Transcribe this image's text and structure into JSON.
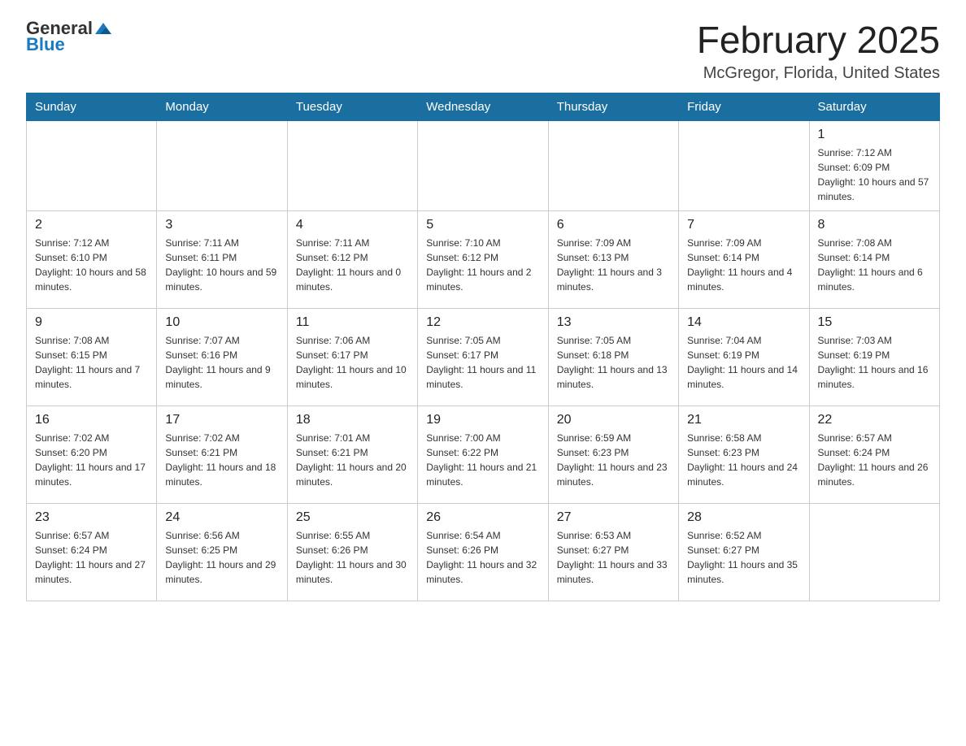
{
  "header": {
    "logo": {
      "general": "General",
      "blue": "Blue"
    },
    "title": "February 2025",
    "location": "McGregor, Florida, United States"
  },
  "weekdays": [
    "Sunday",
    "Monday",
    "Tuesday",
    "Wednesday",
    "Thursday",
    "Friday",
    "Saturday"
  ],
  "weeks": [
    [
      {
        "day": "",
        "sunrise": "",
        "sunset": "",
        "daylight": ""
      },
      {
        "day": "",
        "sunrise": "",
        "sunset": "",
        "daylight": ""
      },
      {
        "day": "",
        "sunrise": "",
        "sunset": "",
        "daylight": ""
      },
      {
        "day": "",
        "sunrise": "",
        "sunset": "",
        "daylight": ""
      },
      {
        "day": "",
        "sunrise": "",
        "sunset": "",
        "daylight": ""
      },
      {
        "day": "",
        "sunrise": "",
        "sunset": "",
        "daylight": ""
      },
      {
        "day": "1",
        "sunrise": "Sunrise: 7:12 AM",
        "sunset": "Sunset: 6:09 PM",
        "daylight": "Daylight: 10 hours and 57 minutes."
      }
    ],
    [
      {
        "day": "2",
        "sunrise": "Sunrise: 7:12 AM",
        "sunset": "Sunset: 6:10 PM",
        "daylight": "Daylight: 10 hours and 58 minutes."
      },
      {
        "day": "3",
        "sunrise": "Sunrise: 7:11 AM",
        "sunset": "Sunset: 6:11 PM",
        "daylight": "Daylight: 10 hours and 59 minutes."
      },
      {
        "day": "4",
        "sunrise": "Sunrise: 7:11 AM",
        "sunset": "Sunset: 6:12 PM",
        "daylight": "Daylight: 11 hours and 0 minutes."
      },
      {
        "day": "5",
        "sunrise": "Sunrise: 7:10 AM",
        "sunset": "Sunset: 6:12 PM",
        "daylight": "Daylight: 11 hours and 2 minutes."
      },
      {
        "day": "6",
        "sunrise": "Sunrise: 7:09 AM",
        "sunset": "Sunset: 6:13 PM",
        "daylight": "Daylight: 11 hours and 3 minutes."
      },
      {
        "day": "7",
        "sunrise": "Sunrise: 7:09 AM",
        "sunset": "Sunset: 6:14 PM",
        "daylight": "Daylight: 11 hours and 4 minutes."
      },
      {
        "day": "8",
        "sunrise": "Sunrise: 7:08 AM",
        "sunset": "Sunset: 6:14 PM",
        "daylight": "Daylight: 11 hours and 6 minutes."
      }
    ],
    [
      {
        "day": "9",
        "sunrise": "Sunrise: 7:08 AM",
        "sunset": "Sunset: 6:15 PM",
        "daylight": "Daylight: 11 hours and 7 minutes."
      },
      {
        "day": "10",
        "sunrise": "Sunrise: 7:07 AM",
        "sunset": "Sunset: 6:16 PM",
        "daylight": "Daylight: 11 hours and 9 minutes."
      },
      {
        "day": "11",
        "sunrise": "Sunrise: 7:06 AM",
        "sunset": "Sunset: 6:17 PM",
        "daylight": "Daylight: 11 hours and 10 minutes."
      },
      {
        "day": "12",
        "sunrise": "Sunrise: 7:05 AM",
        "sunset": "Sunset: 6:17 PM",
        "daylight": "Daylight: 11 hours and 11 minutes."
      },
      {
        "day": "13",
        "sunrise": "Sunrise: 7:05 AM",
        "sunset": "Sunset: 6:18 PM",
        "daylight": "Daylight: 11 hours and 13 minutes."
      },
      {
        "day": "14",
        "sunrise": "Sunrise: 7:04 AM",
        "sunset": "Sunset: 6:19 PM",
        "daylight": "Daylight: 11 hours and 14 minutes."
      },
      {
        "day": "15",
        "sunrise": "Sunrise: 7:03 AM",
        "sunset": "Sunset: 6:19 PM",
        "daylight": "Daylight: 11 hours and 16 minutes."
      }
    ],
    [
      {
        "day": "16",
        "sunrise": "Sunrise: 7:02 AM",
        "sunset": "Sunset: 6:20 PM",
        "daylight": "Daylight: 11 hours and 17 minutes."
      },
      {
        "day": "17",
        "sunrise": "Sunrise: 7:02 AM",
        "sunset": "Sunset: 6:21 PM",
        "daylight": "Daylight: 11 hours and 18 minutes."
      },
      {
        "day": "18",
        "sunrise": "Sunrise: 7:01 AM",
        "sunset": "Sunset: 6:21 PM",
        "daylight": "Daylight: 11 hours and 20 minutes."
      },
      {
        "day": "19",
        "sunrise": "Sunrise: 7:00 AM",
        "sunset": "Sunset: 6:22 PM",
        "daylight": "Daylight: 11 hours and 21 minutes."
      },
      {
        "day": "20",
        "sunrise": "Sunrise: 6:59 AM",
        "sunset": "Sunset: 6:23 PM",
        "daylight": "Daylight: 11 hours and 23 minutes."
      },
      {
        "day": "21",
        "sunrise": "Sunrise: 6:58 AM",
        "sunset": "Sunset: 6:23 PM",
        "daylight": "Daylight: 11 hours and 24 minutes."
      },
      {
        "day": "22",
        "sunrise": "Sunrise: 6:57 AM",
        "sunset": "Sunset: 6:24 PM",
        "daylight": "Daylight: 11 hours and 26 minutes."
      }
    ],
    [
      {
        "day": "23",
        "sunrise": "Sunrise: 6:57 AM",
        "sunset": "Sunset: 6:24 PM",
        "daylight": "Daylight: 11 hours and 27 minutes."
      },
      {
        "day": "24",
        "sunrise": "Sunrise: 6:56 AM",
        "sunset": "Sunset: 6:25 PM",
        "daylight": "Daylight: 11 hours and 29 minutes."
      },
      {
        "day": "25",
        "sunrise": "Sunrise: 6:55 AM",
        "sunset": "Sunset: 6:26 PM",
        "daylight": "Daylight: 11 hours and 30 minutes."
      },
      {
        "day": "26",
        "sunrise": "Sunrise: 6:54 AM",
        "sunset": "Sunset: 6:26 PM",
        "daylight": "Daylight: 11 hours and 32 minutes."
      },
      {
        "day": "27",
        "sunrise": "Sunrise: 6:53 AM",
        "sunset": "Sunset: 6:27 PM",
        "daylight": "Daylight: 11 hours and 33 minutes."
      },
      {
        "day": "28",
        "sunrise": "Sunrise: 6:52 AM",
        "sunset": "Sunset: 6:27 PM",
        "daylight": "Daylight: 11 hours and 35 minutes."
      },
      {
        "day": "",
        "sunrise": "",
        "sunset": "",
        "daylight": ""
      }
    ]
  ],
  "colors": {
    "header_bg": "#1a6fa0",
    "header_text": "#ffffff",
    "border": "#cccccc",
    "day_number": "#222222",
    "day_info": "#333333"
  }
}
